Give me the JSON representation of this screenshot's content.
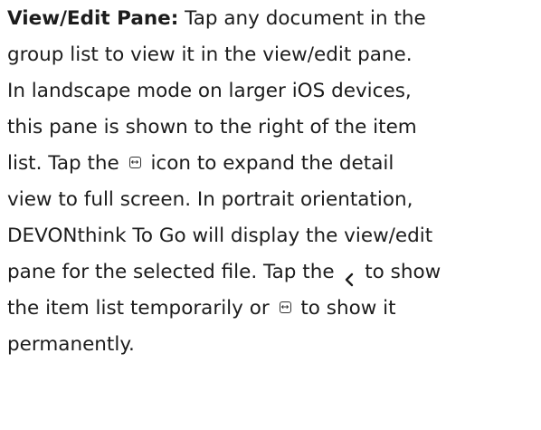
{
  "paragraph": {
    "heading": "View/Edit Pane:",
    "lines": [
      " Tap any document in the",
      "group list to view it in the view/edit pane.",
      "In landscape mode on larger iOS devices,",
      "this pane is shown to the right of the item",
      "list. Tap the ",
      " icon to expand the detail",
      "view to full screen. In portrait orientation,",
      "DEVONthink To Go will display the view/edit",
      "pane for the selected file. Tap the ",
      " to show",
      "the item list temporarily or ",
      " to show it",
      "permanently."
    ]
  },
  "icons": {
    "expand": "expand-icon",
    "back": "chevron-left-icon"
  }
}
